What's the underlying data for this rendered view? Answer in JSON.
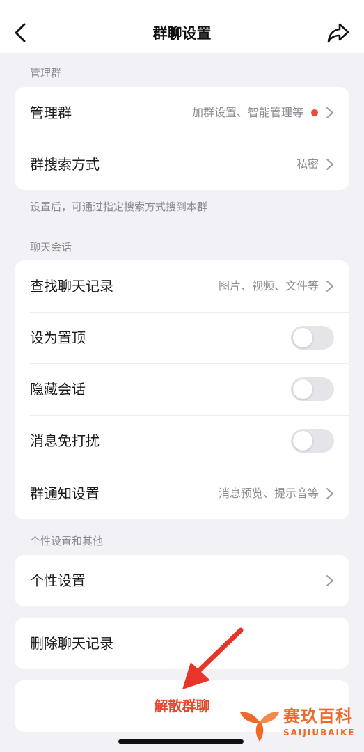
{
  "header": {
    "title": "群聊设置",
    "back_icon": "chevron-left-icon",
    "share_icon": "share-icon"
  },
  "manage_section": {
    "label": "管理群",
    "items": [
      {
        "title": "管理群",
        "value": "加群设置、智能管理等",
        "has_dot": true
      },
      {
        "title": "群搜索方式",
        "value": "私密"
      }
    ],
    "hint": "设置后，可通过指定搜索方式搜到本群"
  },
  "chat_section": {
    "label": "聊天会话",
    "items": [
      {
        "title": "查找聊天记录",
        "value": "图片、视频、文件等"
      },
      {
        "title": "设为置顶",
        "toggle": false
      },
      {
        "title": "隐藏会话",
        "toggle": false
      },
      {
        "title": "消息免打扰",
        "toggle": false
      },
      {
        "title": "群通知设置",
        "value": "消息预览、提示音等"
      }
    ]
  },
  "personal_section": {
    "label": "个性设置和其他",
    "items": [
      {
        "title": "个性设置"
      }
    ]
  },
  "delete_history": {
    "title": "删除聊天记录"
  },
  "dissolve": {
    "title": "解散群聊"
  },
  "watermark": {
    "text_cn": "赛玖百科",
    "text_en": "SAIJIUBAIKE"
  },
  "colors": {
    "accent_red": "#e5472f",
    "dot_red": "#f04b3a",
    "background": "#f2f2f6",
    "arrow_red": "#e8352a"
  }
}
